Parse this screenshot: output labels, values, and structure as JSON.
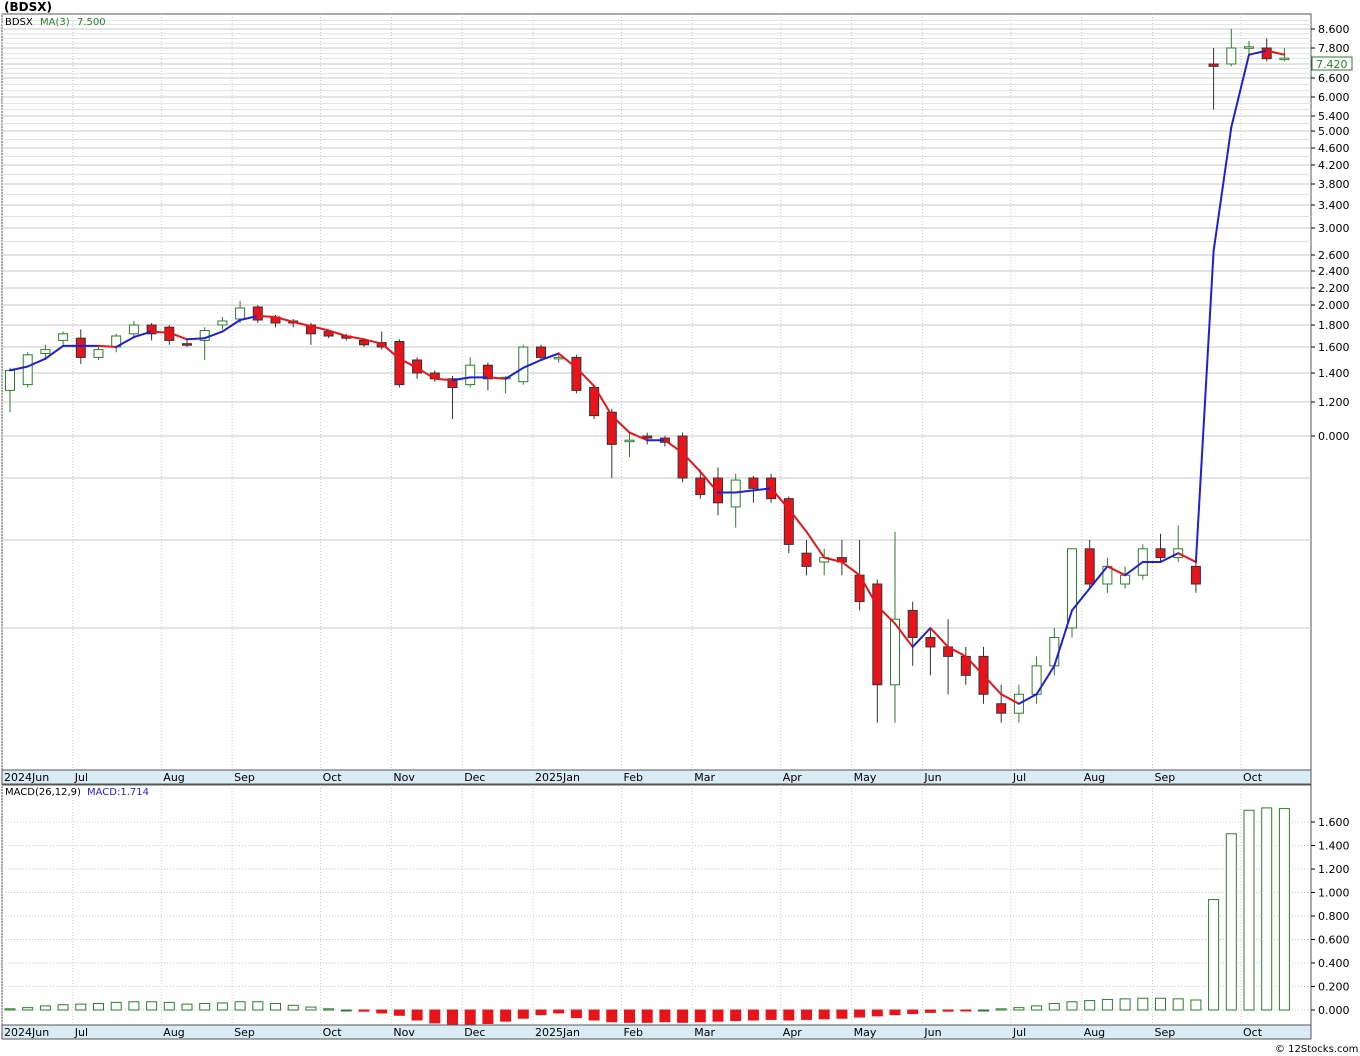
{
  "page": {
    "title": "(BDSX)",
    "watermark": "© 12Stocks.com"
  },
  "colors": {
    "up_candle": "#2e7d2e",
    "down_candle": "#e8141b",
    "ma_up": "#1f1fd6",
    "ma_down": "#e8141b",
    "grid": "#c8c8c8",
    "axis_band": "#d9ecf5",
    "macd_up": "#2e7d2e",
    "macd_down": "#e8141b"
  },
  "chart_data": [
    {
      "type": "candlestick",
      "legend_ticker": "BDSX",
      "legend_ma_label": "MA(3)",
      "legend_ma_value": "7.500",
      "last_price_label": "7.420",
      "y_axis_ticks": [
        "8.600",
        "7.800",
        "7.200",
        "6.600",
        "6.000",
        "5.400",
        "5.000",
        "4.600",
        "4.200",
        "3.800",
        "3.400",
        "3.000",
        "2.600",
        "2.400",
        "2.200",
        "2.000",
        "1.800",
        "1.600",
        "1.400",
        "1.200",
        "0.000"
      ],
      "x_axis_labels": [
        "2024Jun",
        "Jul",
        "Aug",
        "Sep",
        "Oct",
        "Nov",
        "Dec",
        "2025Jan",
        "Feb",
        "Mar",
        "Apr",
        "May",
        "Jun",
        "Jul",
        "Aug",
        "Sep",
        "Oct"
      ],
      "candles": [
        {
          "o": 1.28,
          "h": 1.44,
          "l": 1.14,
          "c": 1.42
        },
        {
          "o": 1.32,
          "h": 1.56,
          "l": 1.3,
          "c": 1.54
        },
        {
          "o": 1.55,
          "h": 1.62,
          "l": 1.5,
          "c": 1.58
        },
        {
          "o": 1.66,
          "h": 1.74,
          "l": 1.62,
          "c": 1.72
        },
        {
          "o": 1.68,
          "h": 1.76,
          "l": 1.47,
          "c": 1.52
        },
        {
          "o": 1.52,
          "h": 1.6,
          "l": 1.5,
          "c": 1.58
        },
        {
          "o": 1.6,
          "h": 1.72,
          "l": 1.56,
          "c": 1.7
        },
        {
          "o": 1.72,
          "h": 1.84,
          "l": 1.68,
          "c": 1.8
        },
        {
          "o": 1.8,
          "h": 1.82,
          "l": 1.66,
          "c": 1.72
        },
        {
          "o": 1.78,
          "h": 1.8,
          "l": 1.62,
          "c": 1.66
        },
        {
          "o": 1.63,
          "h": 1.66,
          "l": 1.6,
          "c": 1.62
        },
        {
          "o": 1.66,
          "h": 1.78,
          "l": 1.5,
          "c": 1.75
        },
        {
          "o": 1.8,
          "h": 1.88,
          "l": 1.76,
          "c": 1.84
        },
        {
          "o": 1.86,
          "h": 2.05,
          "l": 1.82,
          "c": 1.97
        },
        {
          "o": 1.98,
          "h": 2.0,
          "l": 1.82,
          "c": 1.85
        },
        {
          "o": 1.88,
          "h": 1.9,
          "l": 1.78,
          "c": 1.82
        },
        {
          "o": 1.84,
          "h": 1.86,
          "l": 1.78,
          "c": 1.82
        },
        {
          "o": 1.8,
          "h": 1.82,
          "l": 1.62,
          "c": 1.72
        },
        {
          "o": 1.74,
          "h": 1.76,
          "l": 1.68,
          "c": 1.7
        },
        {
          "o": 1.7,
          "h": 1.72,
          "l": 1.66,
          "c": 1.68
        },
        {
          "o": 1.66,
          "h": 1.68,
          "l": 1.6,
          "c": 1.62
        },
        {
          "o": 1.64,
          "h": 1.74,
          "l": 1.58,
          "c": 1.6
        },
        {
          "o": 1.65,
          "h": 1.67,
          "l": 1.3,
          "c": 1.32
        },
        {
          "o": 1.5,
          "h": 1.52,
          "l": 1.36,
          "c": 1.4
        },
        {
          "o": 1.4,
          "h": 1.42,
          "l": 1.34,
          "c": 1.36
        },
        {
          "o": 1.36,
          "h": 1.38,
          "l": 1.1,
          "c": 1.3
        },
        {
          "o": 1.32,
          "h": 1.52,
          "l": 1.3,
          "c": 1.46
        },
        {
          "o": 1.46,
          "h": 1.48,
          "l": 1.28,
          "c": 1.36
        },
        {
          "o": 1.36,
          "h": 1.38,
          "l": 1.26,
          "c": 1.37
        },
        {
          "o": 1.34,
          "h": 1.62,
          "l": 1.32,
          "c": 1.6
        },
        {
          "o": 1.6,
          "h": 1.62,
          "l": 1.5,
          "c": 1.52
        },
        {
          "o": 1.52,
          "h": 1.56,
          "l": 1.48,
          "c": 1.52
        },
        {
          "o": 1.52,
          "h": 1.54,
          "l": 1.26,
          "c": 1.28
        },
        {
          "o": 1.3,
          "h": 1.32,
          "l": 1.1,
          "c": 1.12
        },
        {
          "o": 1.14,
          "h": 1.16,
          "l": 0.8,
          "c": 0.96
        },
        {
          "o": 0.98,
          "h": 1.02,
          "l": 0.9,
          "c": 0.98
        },
        {
          "o": 1.0,
          "h": 1.02,
          "l": 0.96,
          "c": 0.99
        },
        {
          "o": 0.99,
          "h": 1.0,
          "l": 0.95,
          "c": 0.97
        },
        {
          "o": 1.0,
          "h": 1.02,
          "l": 0.78,
          "c": 0.8
        },
        {
          "o": 0.8,
          "h": 0.84,
          "l": 0.7,
          "c": 0.72
        },
        {
          "o": 0.8,
          "h": 0.85,
          "l": 0.62,
          "c": 0.68
        },
        {
          "o": 0.66,
          "h": 0.82,
          "l": 0.56,
          "c": 0.79
        },
        {
          "o": 0.8,
          "h": 0.81,
          "l": 0.68,
          "c": 0.75
        },
        {
          "o": 0.8,
          "h": 0.82,
          "l": 0.68,
          "c": 0.7
        },
        {
          "o": 0.7,
          "h": 0.71,
          "l": 0.47,
          "c": 0.49
        },
        {
          "o": 0.47,
          "h": 0.5,
          "l": 0.42,
          "c": 0.44
        },
        {
          "o": 0.45,
          "h": 0.48,
          "l": 0.42,
          "c": 0.46
        },
        {
          "o": 0.46,
          "h": 0.5,
          "l": 0.42,
          "c": 0.45
        },
        {
          "o": 0.42,
          "h": 0.5,
          "l": 0.34,
          "c": 0.36
        },
        {
          "o": 0.4,
          "h": 0.41,
          "l": 0.2,
          "c": 0.24
        },
        {
          "o": 0.24,
          "h": 0.54,
          "l": 0.2,
          "c": 0.32
        },
        {
          "o": 0.34,
          "h": 0.36,
          "l": 0.26,
          "c": 0.29
        },
        {
          "o": 0.29,
          "h": 0.3,
          "l": 0.25,
          "c": 0.28
        },
        {
          "o": 0.28,
          "h": 0.32,
          "l": 0.23,
          "c": 0.27
        },
        {
          "o": 0.27,
          "h": 0.28,
          "l": 0.24,
          "c": 0.25
        },
        {
          "o": 0.27,
          "h": 0.28,
          "l": 0.22,
          "c": 0.23
        },
        {
          "o": 0.22,
          "h": 0.24,
          "l": 0.2,
          "c": 0.21
        },
        {
          "o": 0.21,
          "h": 0.24,
          "l": 0.2,
          "c": 0.23
        },
        {
          "o": 0.23,
          "h": 0.27,
          "l": 0.22,
          "c": 0.26
        },
        {
          "o": 0.26,
          "h": 0.3,
          "l": 0.25,
          "c": 0.29
        },
        {
          "o": 0.3,
          "h": 0.48,
          "l": 0.29,
          "c": 0.48
        },
        {
          "o": 0.48,
          "h": 0.5,
          "l": 0.39,
          "c": 0.4
        },
        {
          "o": 0.4,
          "h": 0.46,
          "l": 0.38,
          "c": 0.44
        },
        {
          "o": 0.4,
          "h": 0.44,
          "l": 0.39,
          "c": 0.42
        },
        {
          "o": 0.42,
          "h": 0.49,
          "l": 0.41,
          "c": 0.48
        },
        {
          "o": 0.48,
          "h": 0.53,
          "l": 0.45,
          "c": 0.46
        },
        {
          "o": 0.46,
          "h": 0.57,
          "l": 0.45,
          "c": 0.48
        },
        {
          "o": 0.44,
          "h": 0.46,
          "l": 0.38,
          "c": 0.4
        },
        {
          "o": 7.2,
          "h": 7.8,
          "l": 5.6,
          "c": 7.1
        },
        {
          "o": 7.2,
          "h": 8.6,
          "l": 7.1,
          "c": 7.8
        },
        {
          "o": 7.8,
          "h": 8.1,
          "l": 7.6,
          "c": 7.85
        },
        {
          "o": 7.8,
          "h": 8.2,
          "l": 7.3,
          "c": 7.4
        },
        {
          "o": 7.4,
          "h": 7.8,
          "l": 7.3,
          "c": 7.42
        }
      ],
      "ma": [
        1.42,
        1.45,
        1.51,
        1.61,
        1.61,
        1.61,
        1.6,
        1.69,
        1.74,
        1.73,
        1.67,
        1.68,
        1.74,
        1.85,
        1.89,
        1.88,
        1.83,
        1.79,
        1.75,
        1.7,
        1.67,
        1.63,
        1.51,
        1.44,
        1.36,
        1.35,
        1.37,
        1.37,
        1.36,
        1.44,
        1.5,
        1.55,
        1.44,
        1.31,
        1.12,
        1.02,
        0.98,
        0.98,
        0.92,
        0.83,
        0.73,
        0.73,
        0.74,
        0.75,
        0.65,
        0.54,
        0.46,
        0.45,
        0.42,
        0.35,
        0.31,
        0.28,
        0.3,
        0.28,
        0.27,
        0.25,
        0.23,
        0.22,
        0.23,
        0.26,
        0.34,
        0.39,
        0.44,
        0.42,
        0.45,
        0.45,
        0.47,
        0.45,
        2.66,
        5.1,
        7.55,
        7.7,
        7.55
      ],
      "ma_label_note": ""
    },
    {
      "type": "bar",
      "legend_label": "MACD(26,12,9)",
      "legend_value": "MACD:1.714",
      "y_axis_ticks": [
        "1.600",
        "1.400",
        "1.200",
        "1.000",
        "0.800",
        "0.600",
        "0.400",
        "0.200",
        "0.000"
      ],
      "x_axis_labels": [
        "2024Jun",
        "Jul",
        "Aug",
        "Sep",
        "Oct",
        "Nov",
        "Dec",
        "2025Jan",
        "Feb",
        "Mar",
        "Apr",
        "May",
        "Jun",
        "Jul",
        "Aug",
        "Sep",
        "Oct"
      ],
      "values": [
        0.01,
        0.02,
        0.035,
        0.045,
        0.05,
        0.055,
        0.065,
        0.07,
        0.07,
        0.065,
        0.05,
        0.055,
        0.06,
        0.07,
        0.07,
        0.055,
        0.04,
        0.025,
        0.01,
        0.0,
        -0.01,
        -0.025,
        -0.045,
        -0.085,
        -0.11,
        -0.12,
        -0.12,
        -0.115,
        -0.095,
        -0.07,
        -0.04,
        -0.025,
        -0.065,
        -0.085,
        -0.1,
        -0.105,
        -0.105,
        -0.1,
        -0.105,
        -0.1,
        -0.095,
        -0.09,
        -0.085,
        -0.08,
        -0.085,
        -0.08,
        -0.075,
        -0.07,
        -0.06,
        -0.05,
        -0.04,
        -0.03,
        -0.02,
        -0.01,
        -0.005,
        0.0,
        0.01,
        0.02,
        0.035,
        0.055,
        0.07,
        0.08,
        0.09,
        0.095,
        0.1,
        0.1,
        0.095,
        0.085,
        0.94,
        1.5,
        1.7,
        1.72,
        1.714
      ]
    }
  ]
}
